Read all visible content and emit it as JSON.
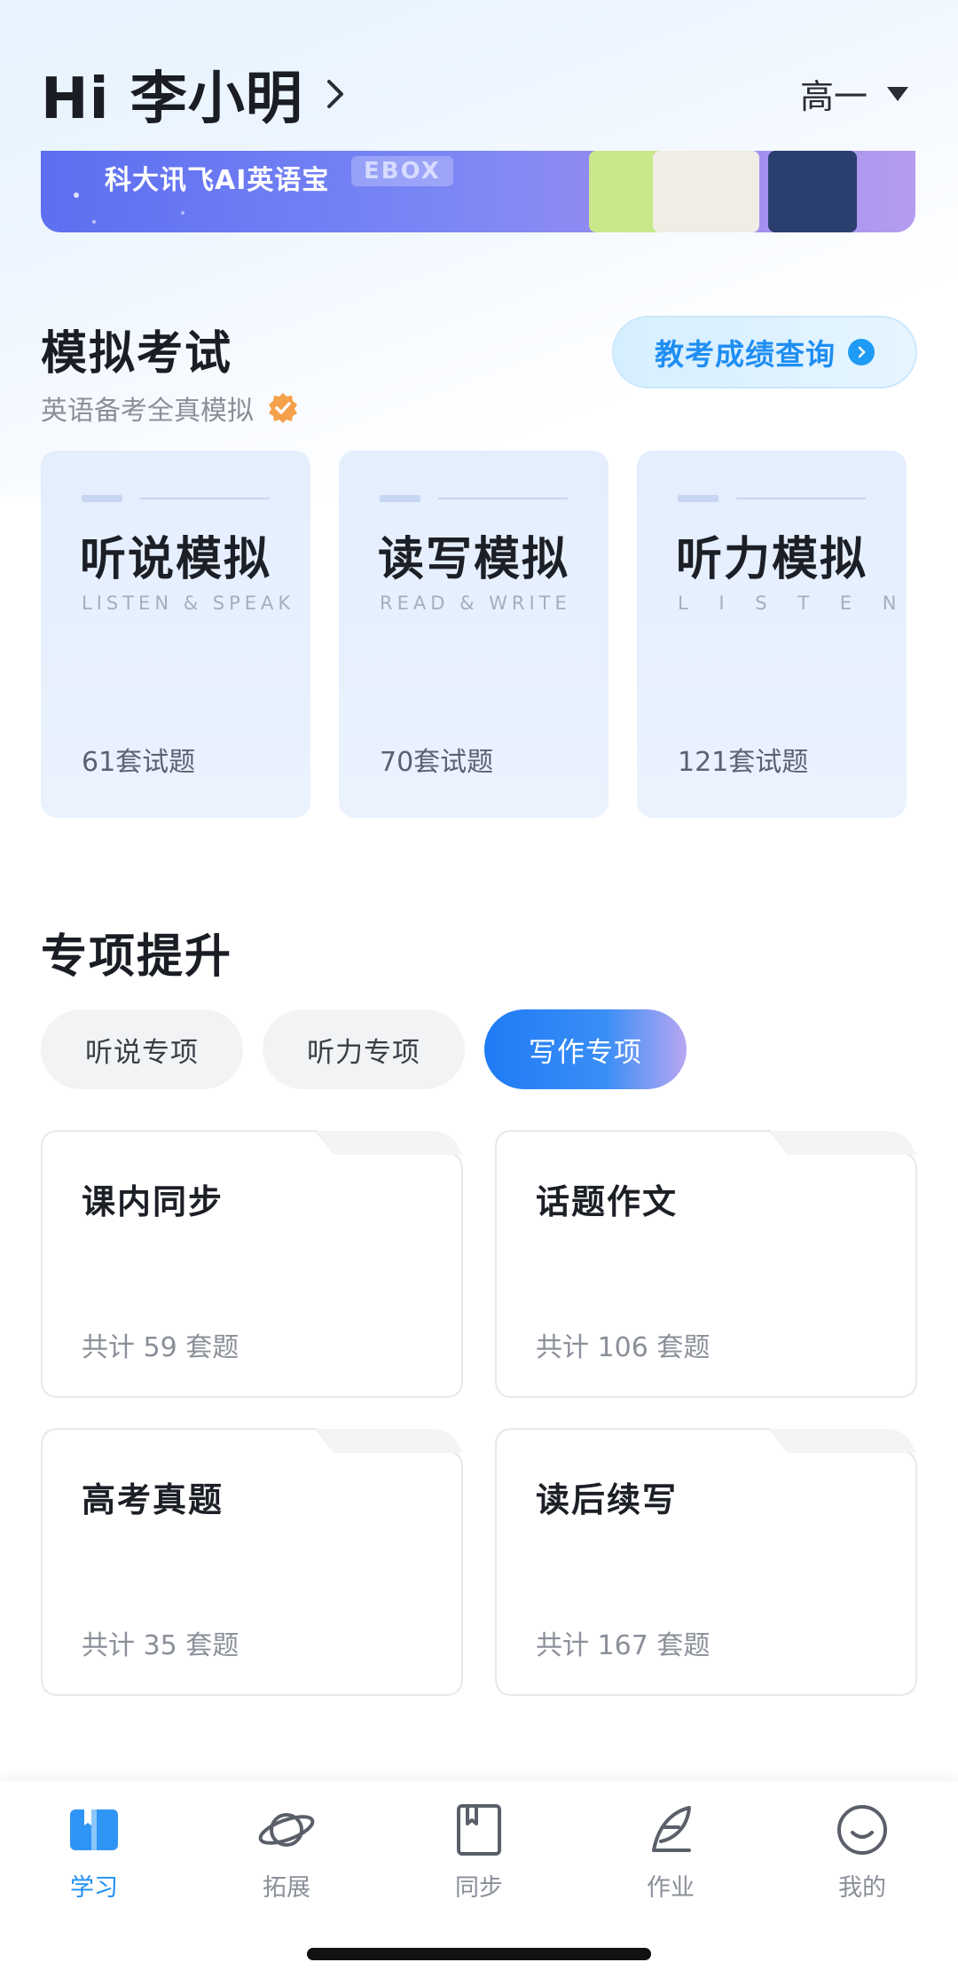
{
  "header": {
    "greeting": "Hi 李小明",
    "grade": "高一"
  },
  "banner": {
    "text": "科大讯飞AI英语宝",
    "tag": "EBOX"
  },
  "mock_exam": {
    "title": "模拟考试",
    "subtitle": "英语备考全真模拟",
    "score_button": "教考成绩查询",
    "cards": [
      {
        "title": "听说模拟",
        "english": "LISTEN & SPEAK",
        "count": "61套试题"
      },
      {
        "title": "读写模拟",
        "english": "READ & WRITE",
        "count": "70套试题"
      },
      {
        "title": "听力模拟",
        "english": "L I S T E N",
        "count": "121套试题"
      }
    ]
  },
  "special": {
    "title": "专项提升",
    "tabs": [
      {
        "label": "听说专项",
        "active": false
      },
      {
        "label": "听力专项",
        "active": false
      },
      {
        "label": "写作专项",
        "active": true
      }
    ],
    "cards": [
      {
        "title": "课内同步",
        "count": "共计 59 套题"
      },
      {
        "title": "话题作文",
        "count": "共计 106 套题"
      },
      {
        "title": "高考真题",
        "count": "共计 35 套题"
      },
      {
        "title": "读后续写",
        "count": "共计 167 套题"
      }
    ]
  },
  "nav": {
    "items": [
      {
        "label": "学习",
        "icon": "book-open-icon",
        "active": true
      },
      {
        "label": "拓展",
        "icon": "planet-icon",
        "active": false
      },
      {
        "label": "同步",
        "icon": "notebook-icon",
        "active": false
      },
      {
        "label": "作业",
        "icon": "feather-pen-icon",
        "active": false
      },
      {
        "label": "我的",
        "icon": "smile-face-icon",
        "active": false
      }
    ]
  },
  "colors": {
    "accent": "#1f8ef2",
    "tab_active": "#1f7bf5",
    "card_bg": "#e4eefd"
  }
}
